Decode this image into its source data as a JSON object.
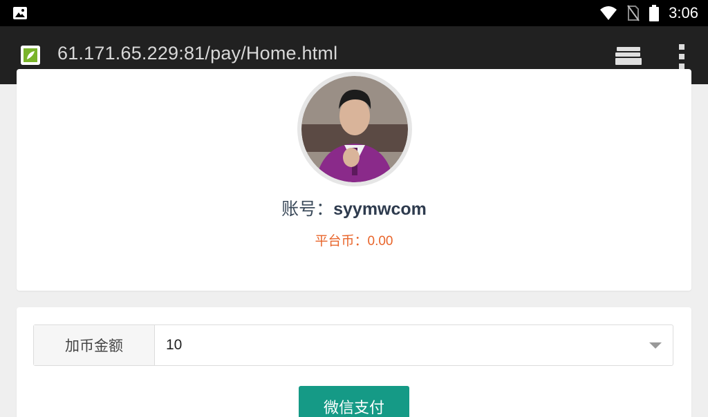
{
  "status_bar": {
    "time": "3:06",
    "icons": [
      "image-notification-icon",
      "wifi-icon",
      "no-sim-icon",
      "battery-icon"
    ]
  },
  "browser": {
    "url": "61.171.65.229:81/pay/Home.html",
    "icons": [
      "site-favicon-icon",
      "tabs-icon",
      "overflow-menu-icon"
    ]
  },
  "profile": {
    "account_label": "账号：",
    "account_value": "syymwcom",
    "coins_label": "平台币：",
    "coins_value": "0.00"
  },
  "form": {
    "amount_label": "加币金额",
    "amount_selected": "10",
    "pay_button_label": "微信支付"
  },
  "colors": {
    "coins_text": "#e8642a",
    "pay_button": "#159a86",
    "toolbar": "#212121"
  }
}
